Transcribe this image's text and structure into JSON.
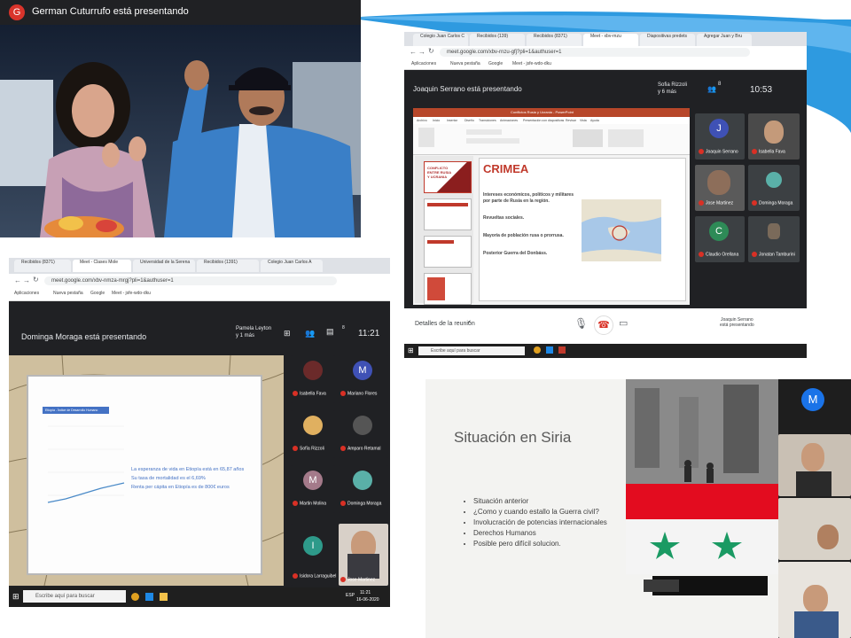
{
  "panel1": {
    "presenter_avatar_letter": "G",
    "presenter_banner": "German Cuturrufo está presentando"
  },
  "panel2": {
    "tabs": [
      "Colegio Juan Carlos C",
      "Recibidos (139)",
      "Recibidos (8371)",
      "Meet - xbv-rnzu",
      "Diapositivas predets",
      "Agregar Juan y Bru"
    ],
    "url": "meet.google.com/xbv-rnzu-gfj?pli=1&authuser=1",
    "bookmarks": [
      "Aplicaciones",
      "Nueva pestaña",
      "Google",
      "Meet - jsfe-wdo-dku"
    ],
    "presenter_banner": "Joaquin Serrano está presentando",
    "viewers": "Sofia Rizzoli\ny 6 más",
    "people_count": "8",
    "time": "10:53",
    "ppt": {
      "window_title": "Conflictos Rusia y Ucrania - PowerPoint",
      "menu": [
        "Archivo",
        "Inicio",
        "Insertar",
        "Diseño",
        "Transiciones",
        "Animaciones",
        "Presentación con diapositivas",
        "Revisar",
        "Vista",
        "Ayuda"
      ],
      "thumb1_title": "CONFLICTO ENTRE RUSIA Y UCRANIA",
      "slide_title": "CRIMEA",
      "bullets": [
        "Intereses económicos, políticos y militares por parte de Rusia en la región.",
        "Revueltas sociales.",
        "Mayoría de población rusa o prorrusa.",
        "Posterior Guerra del Donbáss."
      ]
    },
    "participants": [
      {
        "letter": "J",
        "name": "Joaquin Serrano"
      },
      {
        "letter": "",
        "name": "Isabella Fava"
      },
      {
        "letter": "",
        "name": "Jose Martinez"
      },
      {
        "letter": "",
        "name": "Dominga Moraga"
      },
      {
        "letter": "C",
        "name": "Claudio Orellana"
      },
      {
        "letter": "",
        "name": "Jonatan Tamburini"
      }
    ],
    "meeting_details": "Detalles de la reunión",
    "presenting_label": "Joaquin Serrano\nestá presentando",
    "taskbar_search": "Escribe aquí para buscar",
    "colors": {
      "accent_red": "#d93025",
      "meet_bg": "#202124",
      "ppt_red": "#b7472a"
    }
  },
  "panel3": {
    "tabs": [
      "Recibidos (8371)",
      "Meet - Clases Mole",
      "Universidad de la Serena",
      "Recibidos (1391)",
      "Colegio Juan Carlos A"
    ],
    "url": "meet.google.com/xbv-nmza-mrgj?pli=1&authuser=1",
    "bookmarks": [
      "Aplicaciones",
      "Nueva pestaña",
      "Google",
      "Meet - jsfe-wdo-dku"
    ],
    "presenter_banner": "Dominga Moraga está presentando",
    "viewers": "Pamela Leyton\ny 1 más",
    "people_count": "8",
    "time": "11:21",
    "chart_header": "Etiopía - Índice de Desarrollo Humano",
    "chart_bullets": [
      "La esperanza de vida en Etiopía está en 65,87 años",
      "Su tasa de mortalidad es el 6,69%",
      "Renta per cápita en Etiopía es de 800€ euros"
    ],
    "participants": [
      {
        "letter": "",
        "name": "Isabella Fava"
      },
      {
        "letter": "M",
        "name": "Mariano Flores"
      },
      {
        "letter": "",
        "name": "Sofía Rizzoli"
      },
      {
        "letter": "",
        "name": "Amparo Retamal"
      },
      {
        "letter": "M",
        "name": "Martin Molina"
      },
      {
        "letter": "",
        "name": "Dominga Moraga"
      },
      {
        "letter": "I",
        "name": "Isidora Larraguibel"
      },
      {
        "letter": "",
        "name": "Jose Martinez"
      }
    ],
    "taskbar_search": "Escribe aquí para buscar",
    "taskbar_time": "11:21",
    "taskbar_date": "16-06-2020",
    "taskbar_lang": "ESP"
  },
  "panel4": {
    "slide_title": "Situación en Siria",
    "bullets": [
      "Situación anterior",
      "¿Como y cuando estallo la Guerra civil?",
      "Involucración de potencias internacionales",
      "Derechos Humanos",
      "Posible pero difícil solucion."
    ],
    "participant_letter": "M",
    "colors": {
      "flag_red": "#e30c1f",
      "flag_star": "#1a9a63",
      "meet_blue": "#1a73e8"
    }
  }
}
